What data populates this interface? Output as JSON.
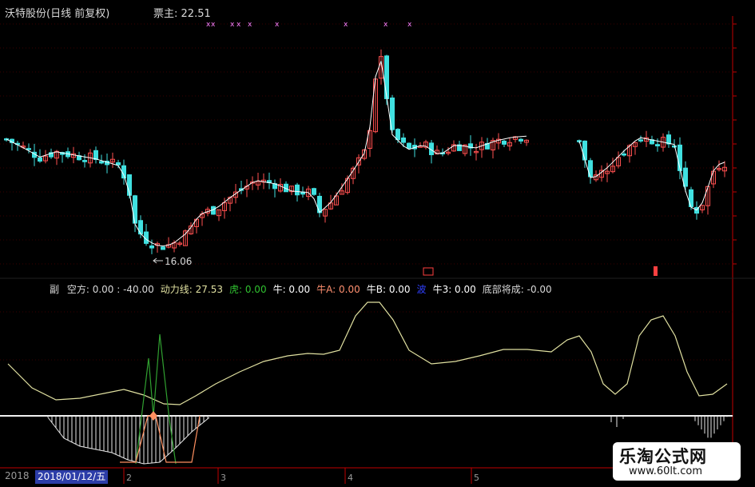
{
  "header": {
    "title": "沃特股份(日线 前复权)",
    "piaozhu_label": "票主",
    "piaozhu_value": ": 22.51"
  },
  "price_panel": {
    "low_label": "16.06"
  },
  "sub_panel": {
    "prefix": "副",
    "indicators": [
      {
        "label": "空方",
        "value": ": 0.00 : -40.00",
        "color": "#d8d8d8"
      },
      {
        "label": "动力线",
        "value": ": 27.53",
        "color": "#e0e0a0"
      },
      {
        "label": "虎",
        "value": ": 0.00",
        "color": "#30c030"
      },
      {
        "label": "牛",
        "value": ": 0.00",
        "color": "#ffffff"
      },
      {
        "label": "牛A",
        "value": ": 0.00",
        "color": "#ff9070"
      },
      {
        "label": "牛B",
        "value": ": 0.00",
        "color": "#ffffff"
      },
      {
        "label": "波",
        "value": "",
        "color": "#3040ff"
      },
      {
        "label": "牛3",
        "value": ": 0.00",
        "color": "#ffffff"
      },
      {
        "label": "底部将成",
        "value": ": -0.00",
        "color": "#d8d8d8"
      }
    ]
  },
  "time_axis": {
    "year": "2018",
    "selected_date": "2018/01/12/五",
    "month_labels": [
      "2",
      "3",
      "4",
      "5"
    ]
  },
  "watermark": {
    "title": "乐淘公式网",
    "url": "www.60lt.com"
  },
  "colors": {
    "up_candle": "#ff5050",
    "down_candle": "#40e0e0",
    "ma_line": "#ffffff",
    "power_line": "#e0e0a0",
    "axis_red": "#c00000"
  },
  "chart_data": {
    "type": "candlestick",
    "title": "沃特股份(日线 前复权)",
    "low_marker": 16.06,
    "indicator_power_line_last": 27.53
  }
}
